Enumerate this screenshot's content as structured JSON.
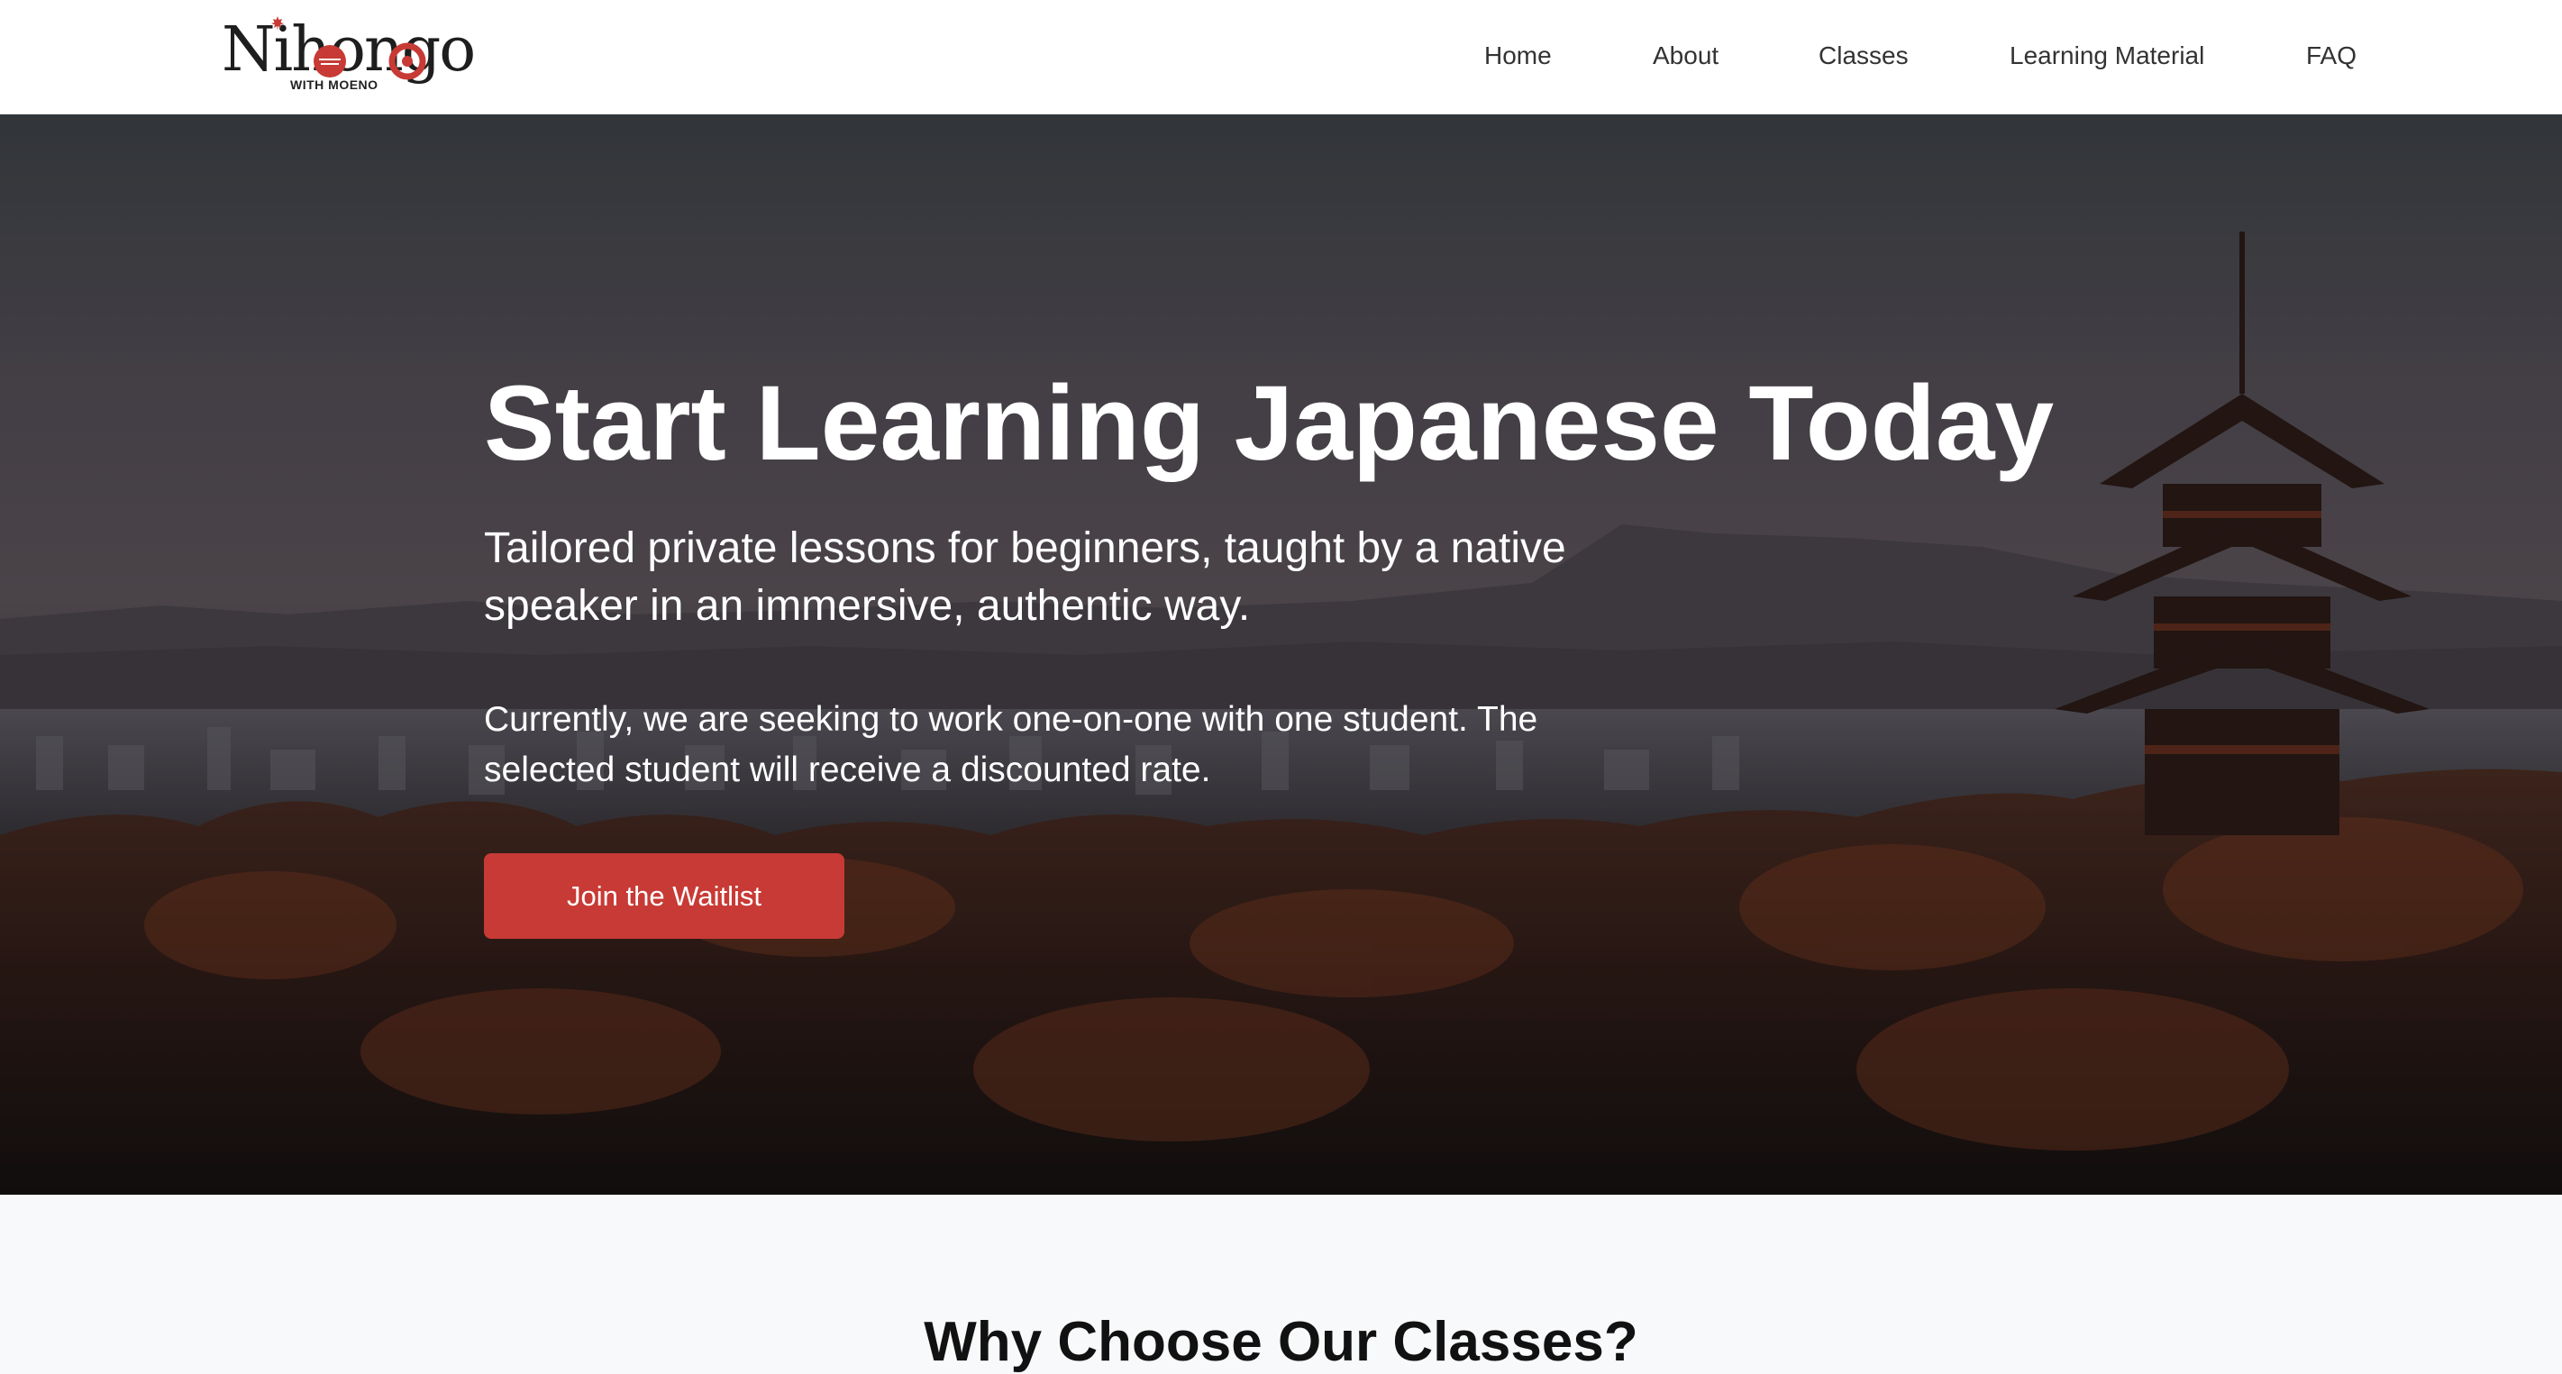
{
  "brand": {
    "name": "Nihongo",
    "tagline": "WITH MOENO",
    "accent_color": "#c83a35"
  },
  "nav": {
    "items": [
      {
        "label": "Home"
      },
      {
        "label": "About"
      },
      {
        "label": "Classes"
      },
      {
        "label": "Learning Material"
      },
      {
        "label": "FAQ"
      }
    ]
  },
  "hero": {
    "title": "Start Learning Japanese Today",
    "subtitle": "Tailored private lessons for beginners, taught by a native speaker in an immersive, authentic way.",
    "note": "Currently, we are seeking to work one-on-one with one student. The selected student will receive a discounted rate.",
    "cta_label": "Join the Waitlist",
    "background_icon": "kyoto-pagoda-landscape"
  },
  "why": {
    "heading": "Why Choose Our Classes?"
  }
}
